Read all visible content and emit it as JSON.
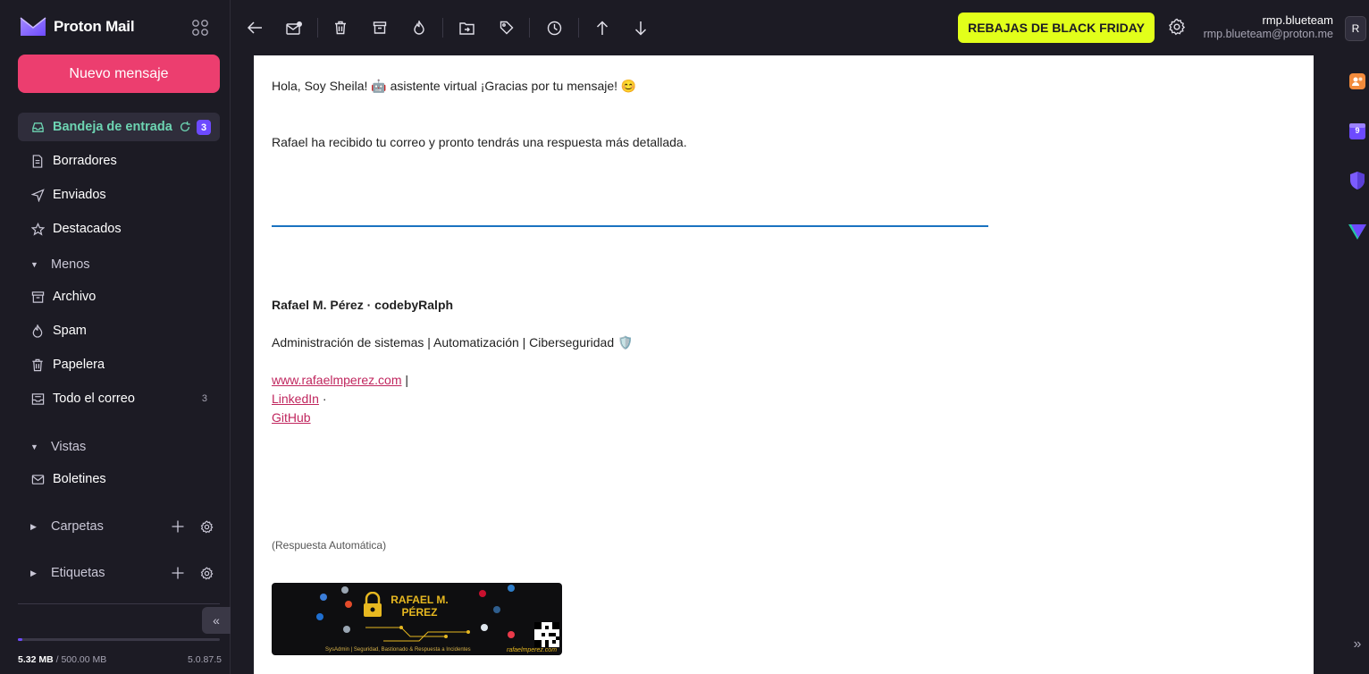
{
  "app": {
    "name": "Proton Mail"
  },
  "sidebar": {
    "compose_label": "Nuevo mensaje",
    "items": [
      {
        "label": "Bandeja de entrada",
        "badge": "3"
      },
      {
        "label": "Borradores"
      },
      {
        "label": "Enviados"
      },
      {
        "label": "Destacados"
      },
      {
        "label": "Menos"
      },
      {
        "label": "Archivo"
      },
      {
        "label": "Spam"
      },
      {
        "label": "Papelera"
      },
      {
        "label": "Todo el correo",
        "count": "3"
      }
    ],
    "views_label": "Vistas",
    "views": [
      {
        "label": "Boletines"
      }
    ],
    "folders_label": "Carpetas",
    "labels_label": "Etiquetas",
    "storage_used": "5.32 MB",
    "storage_total": "/ 500.00 MB",
    "storage_fraction": 0.0106,
    "version": "5.0.87.5"
  },
  "toolbar": {
    "promo_label": "REBAJAS DE BLACK FRIDAY",
    "user_name": "rmp.blueteam",
    "user_email": "rmp.blueteam@proton.me",
    "avatar_initial": "R"
  },
  "rail": {
    "calendar_day": "9"
  },
  "message": {
    "greeting": "Hola, Soy Sheila! 🤖 asistente virtual ¡Gracias por tu mensaje! 😊",
    "body": "Rafael ha recibido tu correo y pronto tendrás una respuesta más detallada.",
    "signature_name": "Rafael M. Pérez · codebyRalph",
    "signature_role": "Administración de sistemas | Automatización | Ciberseguridad 🛡️",
    "link_web": "www.rafaelmperez.com",
    "link_web_sep": " |",
    "link_linkedin": "LinkedIn",
    "link_linkedin_sep": " ·",
    "link_github": "GitHub",
    "auto_reply": "(Respuesta Automática)",
    "banner_title": "RAFAEL M. PÉREZ",
    "banner_subtitle": "SysAdmin | Seguridad, Bastionado & Respuesta a Incidentes",
    "banner_url": "rafaelmperez.com"
  },
  "colors": {
    "accent": "#6d4aff",
    "compose": "#ec3e6f",
    "active_text": "#6dd4b2",
    "promo": "#e2ff1a",
    "link": "#c0265e"
  }
}
